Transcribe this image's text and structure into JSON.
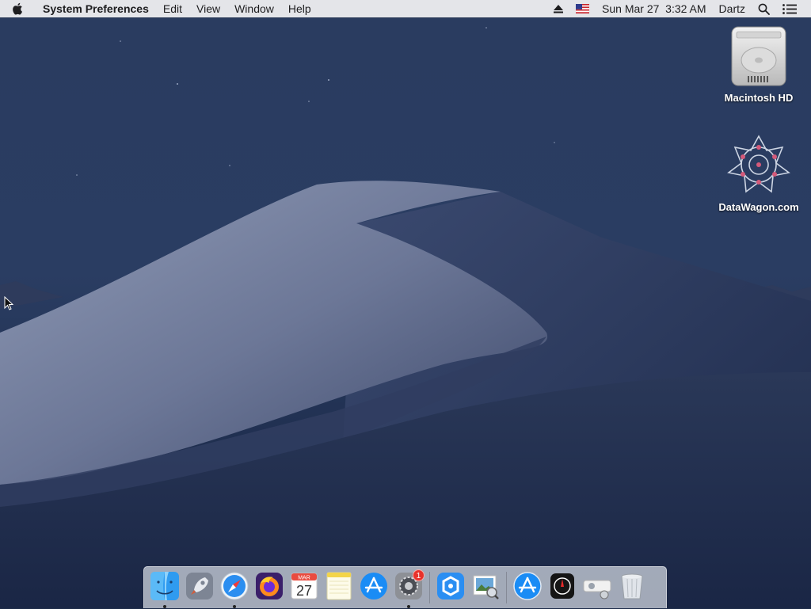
{
  "menubar": {
    "app_name": "System Preferences",
    "menus": [
      "Edit",
      "View",
      "Window",
      "Help"
    ],
    "datetime": "Sun Mar 27  3:32 AM",
    "user": "Dartz"
  },
  "desktop": {
    "icons": [
      {
        "label": "Macintosh HD"
      },
      {
        "label": "DataWagon.com"
      }
    ]
  },
  "dock": {
    "calendar_month": "MAR",
    "calendar_day": "27",
    "sysprefs_badge": "1",
    "items": [
      "finder-icon",
      "launchpad-icon",
      "safari-icon",
      "firefox-icon",
      "calendar-icon",
      "notes-icon",
      "app-store-icon",
      "system-preferences-icon",
      "app-icon",
      "preview-icon",
      "app-store-icon",
      "clock-app-icon",
      "projector-app-icon",
      "trash-icon"
    ]
  },
  "colors": {
    "menubar_bg": "#ececee",
    "badge": "#e8322b",
    "sky_top": "#2a3e62",
    "sky_bottom": "#162341"
  }
}
